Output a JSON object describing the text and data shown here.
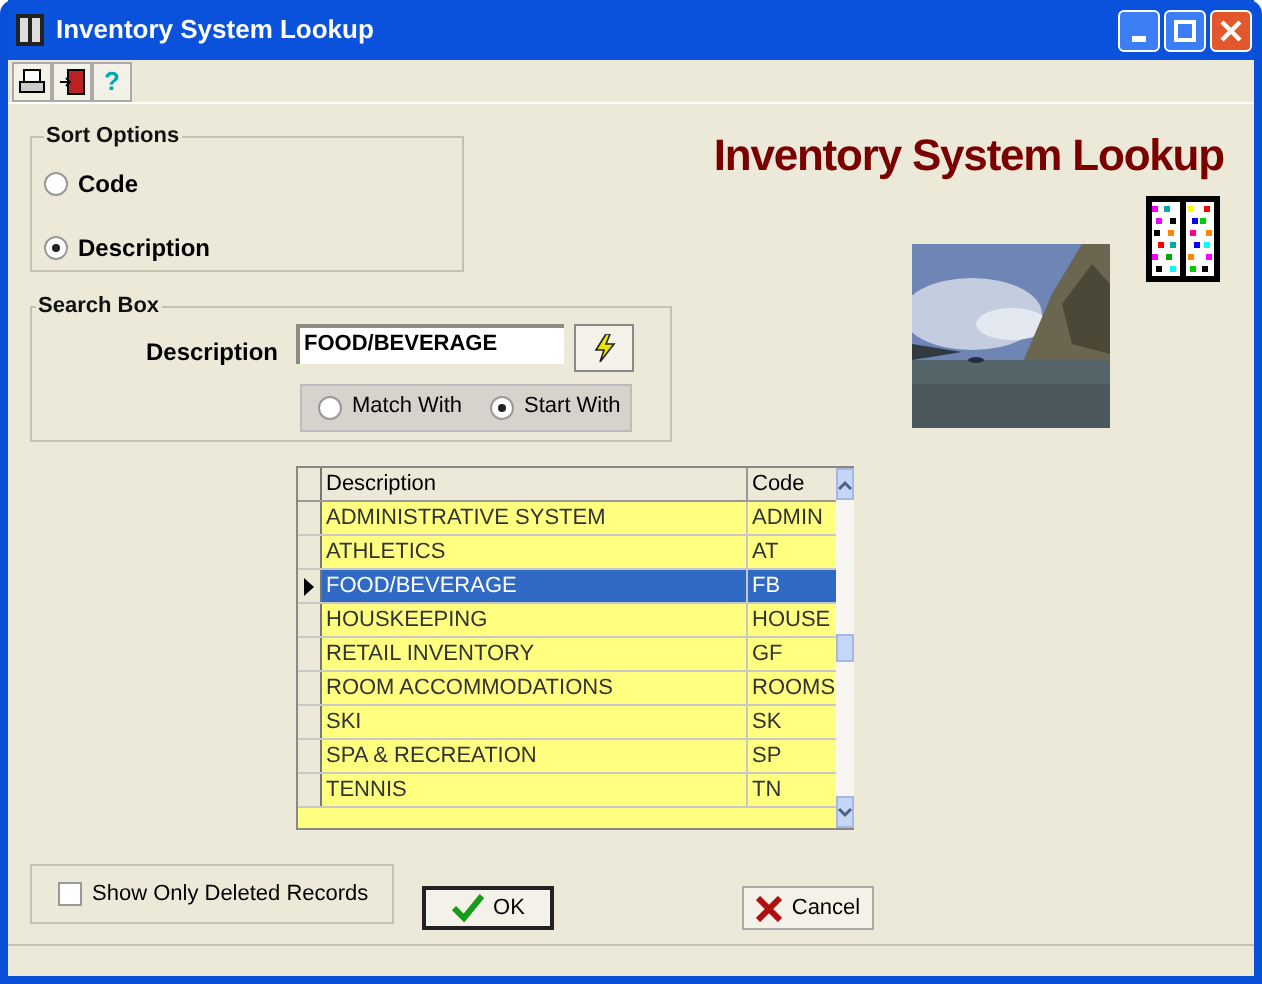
{
  "window": {
    "title": "Inventory System Lookup"
  },
  "toolbar": [
    {
      "kind": "print"
    },
    {
      "kind": "exit"
    },
    {
      "kind": "help",
      "label": "?"
    }
  ],
  "sort_options": {
    "title": "Sort Options",
    "options": [
      {
        "label": "Code",
        "selected": false
      },
      {
        "label": "Description",
        "selected": true
      }
    ]
  },
  "heading": "Inventory System Lookup",
  "search_box": {
    "title": "Search Box",
    "label": "Description",
    "value": "FOOD/BEVERAGE",
    "match_options": [
      {
        "label": "Match With",
        "selected": false
      },
      {
        "label": "Start With",
        "selected": true
      }
    ]
  },
  "table": {
    "columns": [
      "Description",
      "Code"
    ],
    "rows": [
      {
        "description": "ADMINISTRATIVE SYSTEM",
        "code": "ADMIN",
        "selected": false
      },
      {
        "description": "ATHLETICS",
        "code": "AT",
        "selected": false
      },
      {
        "description": "FOOD/BEVERAGE",
        "code": "FB",
        "selected": true
      },
      {
        "description": "HOUSKEEPING",
        "code": "HOUSE",
        "selected": false
      },
      {
        "description": "RETAIL INVENTORY",
        "code": "GF",
        "selected": false
      },
      {
        "description": "ROOM ACCOMMODATIONS",
        "code": "ROOMS",
        "selected": false
      },
      {
        "description": "SKI",
        "code": "SK",
        "selected": false
      },
      {
        "description": "SPA & RECREATION",
        "code": "SP",
        "selected": false
      },
      {
        "description": "TENNIS",
        "code": "TN",
        "selected": false
      }
    ]
  },
  "show_only_deleted": {
    "label": "Show Only Deleted Records",
    "checked": false
  },
  "buttons": [
    {
      "label": "OK",
      "kind": "ok"
    },
    {
      "label": "Cancel",
      "kind": "cancel"
    }
  ]
}
